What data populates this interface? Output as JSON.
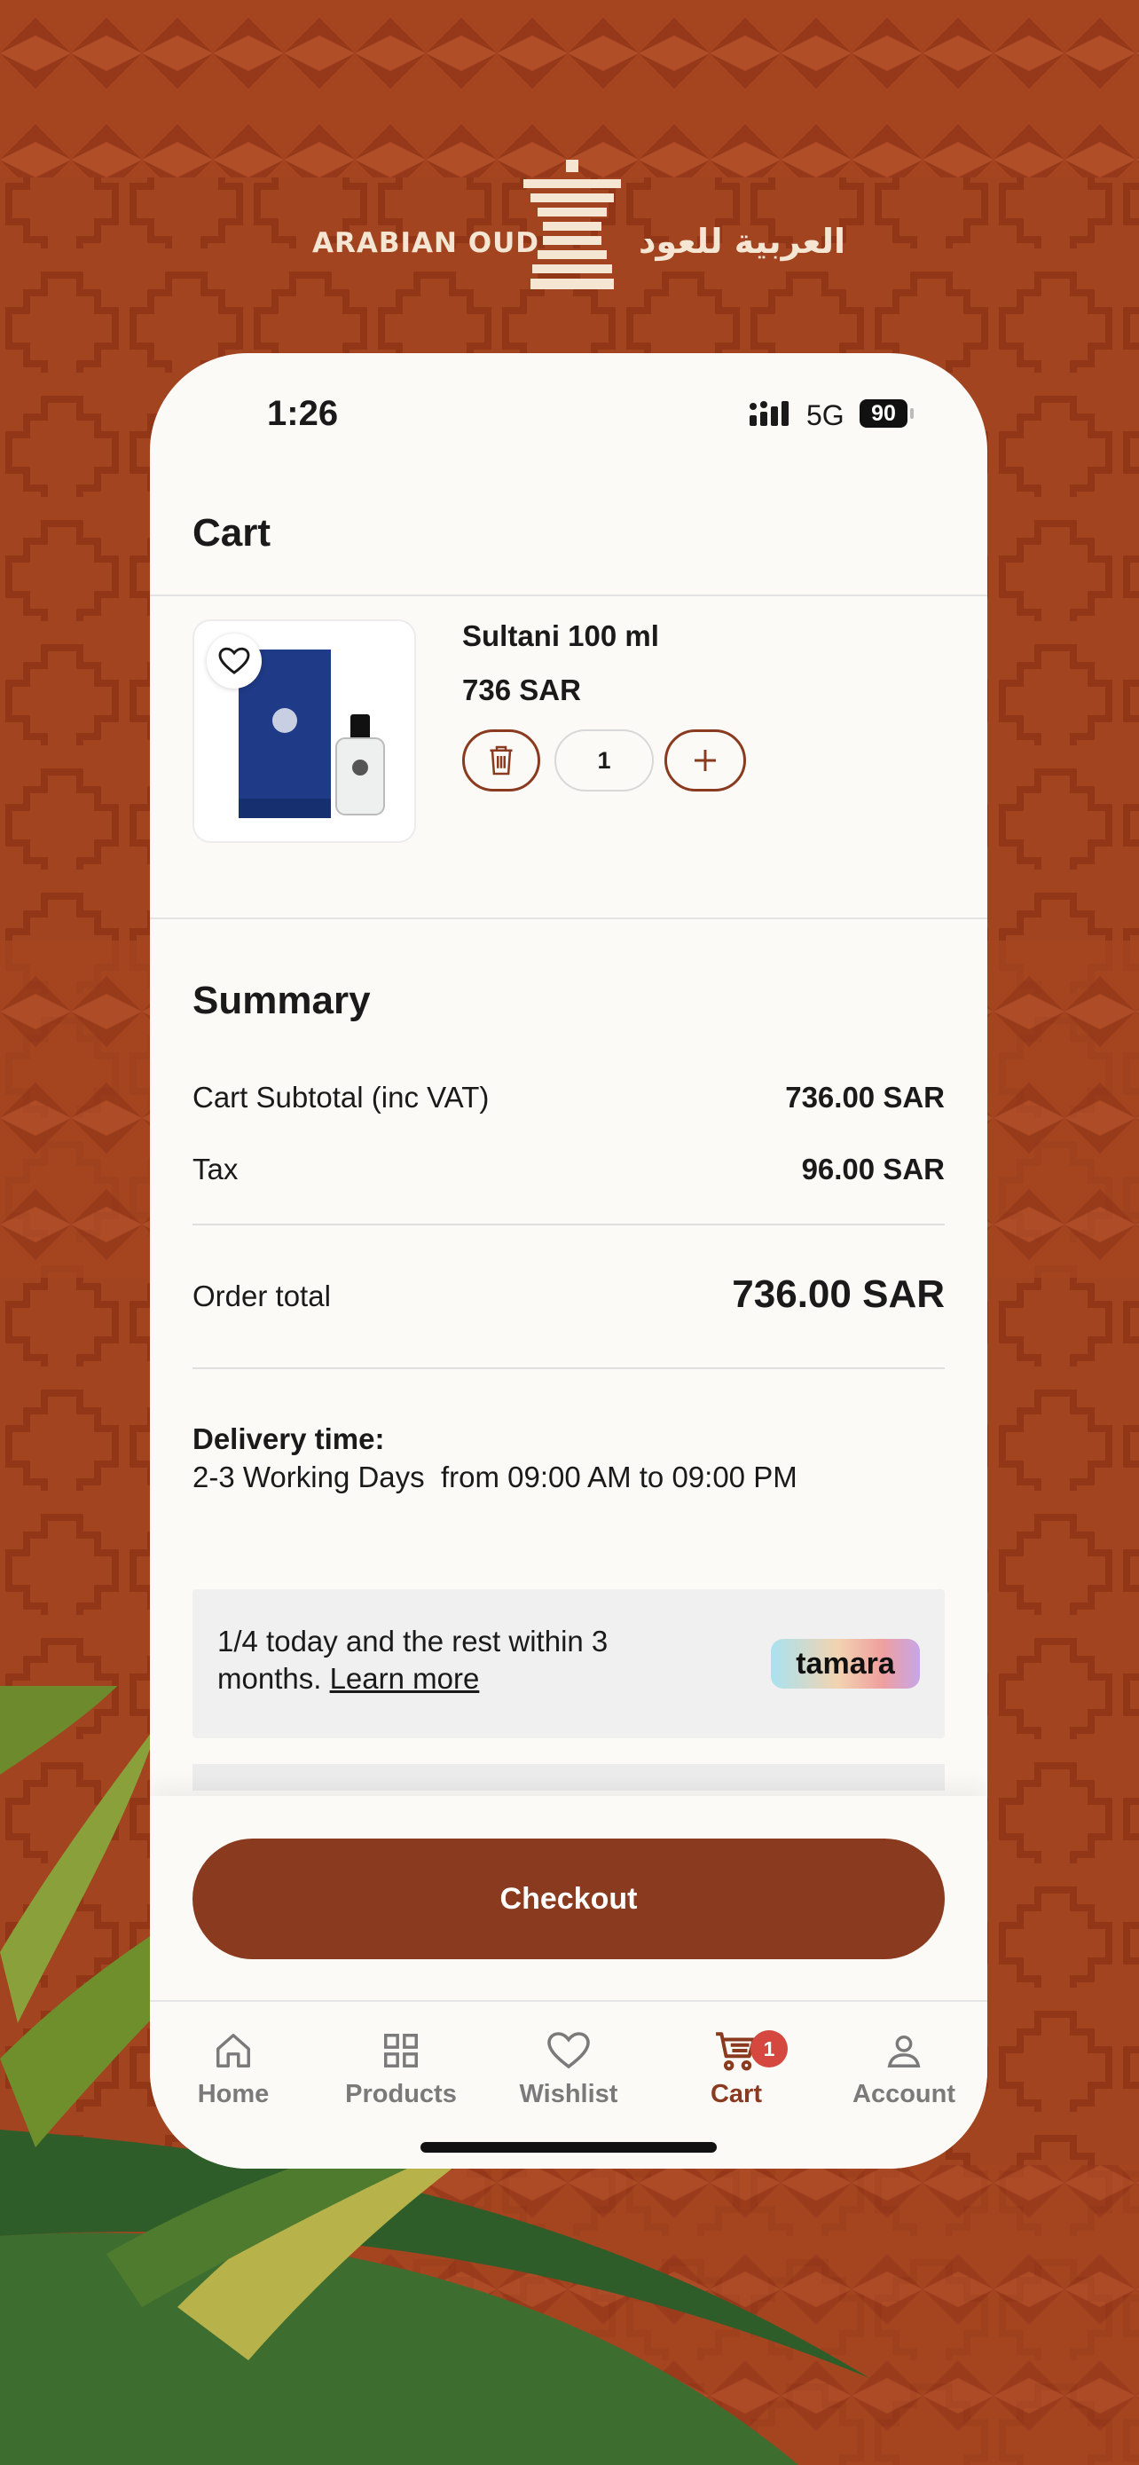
{
  "brand": {
    "name_en": "ARABIAN OUD",
    "name_ar": "العربية للعود"
  },
  "status_bar": {
    "time": "1:26",
    "network": "5G",
    "battery": "90"
  },
  "page": {
    "title": "Cart"
  },
  "cart_item": {
    "name": "Sultani 100 ml",
    "price": "736 SAR",
    "quantity": "1",
    "delete_icon": "trash-icon",
    "increase_icon": "plus-icon",
    "wishlist_icon": "heart-icon"
  },
  "summary": {
    "title": "Summary",
    "subtotal_label": "Cart Subtotal (inc VAT)",
    "subtotal_value": "736.00 SAR",
    "tax_label": "Tax",
    "tax_value": "96.00 SAR",
    "total_label": "Order total",
    "total_value": "736.00 SAR"
  },
  "delivery": {
    "label": "Delivery time:",
    "text": "2-3 Working Days  from 09:00 AM to 09:00 PM"
  },
  "tamara": {
    "text": "1/4 today and the rest within 3 months.",
    "link": "Learn more",
    "badge": "tamara"
  },
  "checkout": {
    "label": "Checkout"
  },
  "tabs": [
    {
      "label": "Home",
      "icon": "home-icon"
    },
    {
      "label": "Products",
      "icon": "grid-icon"
    },
    {
      "label": "Wishlist",
      "icon": "heart-icon"
    },
    {
      "label": "Cart",
      "icon": "cart-icon",
      "badge": "1",
      "active": true
    },
    {
      "label": "Account",
      "icon": "user-icon"
    }
  ],
  "colors": {
    "background": "#a5451f",
    "accent": "#8a3a1e",
    "badge": "#d4483f",
    "surface": "#fbfaf7"
  }
}
